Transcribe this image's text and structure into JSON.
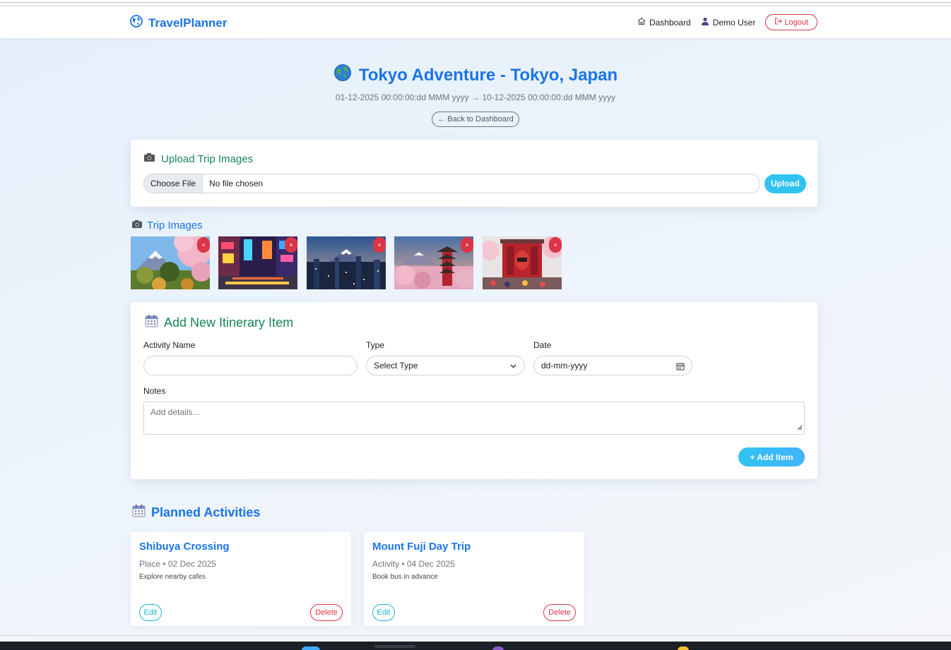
{
  "navbar": {
    "brand": "TravelPlanner",
    "dashboard_label": "Dashboard",
    "user_label": "Demo User",
    "logout_label": "Logout"
  },
  "trip": {
    "title": "Tokyo Adventure - Tokyo, Japan",
    "dates": "01-12-2025 00:00:00:dd MMM yyyy → 10-12-2025 00:00:00:dd MMM yyyy",
    "back_label": "← Back to Dashboard"
  },
  "upload": {
    "heading": "Upload Trip Images",
    "choose_label": "Choose File",
    "status": "No file chosen",
    "button_label": "Upload"
  },
  "images": {
    "heading": "Trip Images",
    "delete_symbol": "×",
    "items": [
      {
        "subject": "Mount Fuji with cherry blossoms"
      },
      {
        "subject": "Neon city street"
      },
      {
        "subject": "City skyline with Mount Fuji"
      },
      {
        "subject": "Pagoda with cherry blossoms and Mount Fuji"
      },
      {
        "subject": "Red temple gate with lantern"
      }
    ]
  },
  "itinerary_form": {
    "heading": "Add New Itinerary Item",
    "activity_label": "Activity Name",
    "activity_value": "",
    "type_label": "Type",
    "type_value": "Select Type",
    "date_label": "Date",
    "date_placeholder": "dd-mm-yyyy",
    "notes_label": "Notes",
    "notes_placeholder": "Add details...",
    "add_label": "+ Add Item"
  },
  "planned": {
    "heading": "Planned Activities",
    "activities": [
      {
        "title": "Shibuya Crossing",
        "meta": "Place • 02 Dec 2025",
        "note": "Explore nearby cafes",
        "edit_label": "Edit",
        "delete_label": "Delete"
      },
      {
        "title": "Mount Fuji Day Trip",
        "meta": "Activity • 04 Dec 2025",
        "note": "Book bus in advance",
        "edit_label": "Edit",
        "delete_label": "Delete"
      }
    ]
  },
  "colors": {
    "primary": "#1a74e8",
    "success": "#198754",
    "danger": "#dc3545",
    "info": "#30c3f0"
  }
}
